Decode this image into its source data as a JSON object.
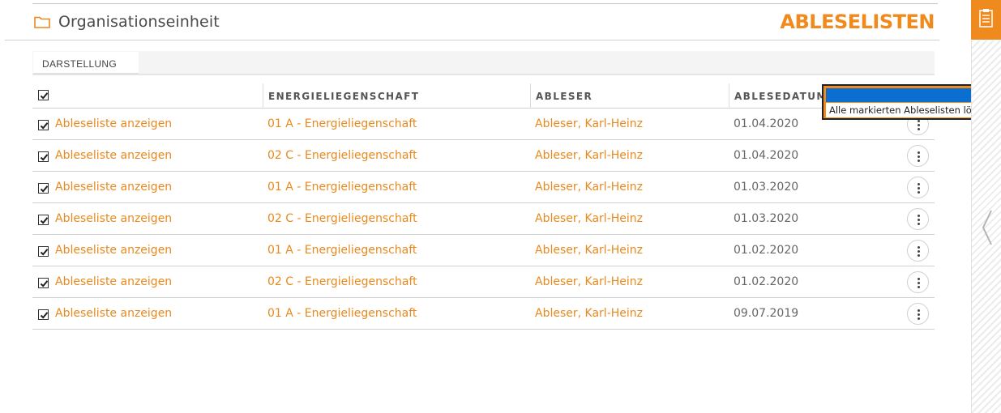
{
  "header": {
    "org_title": "Organisationseinheit",
    "page_title": "ABLESELISTEN",
    "folder_icon": "folder-icon"
  },
  "view_tabs": {
    "label": "DARSTELLUNG"
  },
  "table": {
    "select_all_checked": true,
    "columns": [
      "",
      "ENERGIELIEGENSCHAFT",
      "ABLESER",
      "ABLESEDATUM"
    ],
    "rows": [
      {
        "checked": true,
        "link": "Ableseliste anzeigen",
        "energie": "01 A - Energieliegenschaft",
        "ableser": "Ableser, Karl-Heinz",
        "datum": "01.04.2020"
      },
      {
        "checked": true,
        "link": "Ableseliste anzeigen",
        "energie": "02 C - Energieliegenschaft",
        "ableser": "Ableser, Karl-Heinz",
        "datum": "01.04.2020"
      },
      {
        "checked": true,
        "link": "Ableseliste anzeigen",
        "energie": "01 A - Energieliegenschaft",
        "ableser": "Ableser, Karl-Heinz",
        "datum": "01.03.2020"
      },
      {
        "checked": true,
        "link": "Ableseliste anzeigen",
        "energie": "02 C - Energieliegenschaft",
        "ableser": "Ableser, Karl-Heinz",
        "datum": "01.03.2020"
      },
      {
        "checked": true,
        "link": "Ableseliste anzeigen",
        "energie": "01 A - Energieliegenschaft",
        "ableser": "Ableser, Karl-Heinz",
        "datum": "01.02.2020"
      },
      {
        "checked": true,
        "link": "Ableseliste anzeigen",
        "energie": "02 C - Energieliegenschaft",
        "ableser": "Ableser, Karl-Heinz",
        "datum": "01.02.2020"
      },
      {
        "checked": true,
        "link": "Ableseliste anzeigen",
        "energie": "01 A - Energieliegenschaft",
        "ableser": "Ableser, Karl-Heinz",
        "datum": "09.07.2019"
      }
    ]
  },
  "bulk_action_dropdown": {
    "selected_value": "",
    "options": [
      "Alle markierten Ableselisten löschen"
    ]
  },
  "side_rail": {
    "button_icon": "clipboard-list-icon",
    "toggle_icon": "chevron-left-icon"
  },
  "colors": {
    "accent": "#f08a1c",
    "link": "#e9891d",
    "selection": "#0a6fd1"
  }
}
